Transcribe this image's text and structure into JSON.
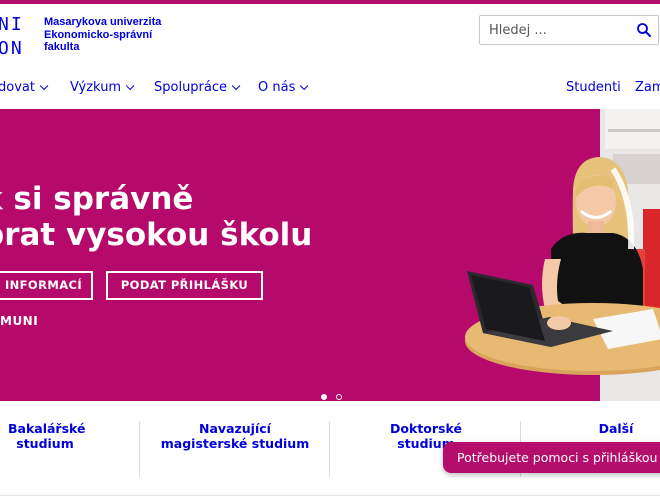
{
  "logo": {
    "mark_top": "NI",
    "mark_bottom": "ON",
    "line1": "Masarykova univerzita",
    "line2": "Ekonomicko-správní",
    "line3": "fakulta"
  },
  "search": {
    "placeholder": "Hledej ...",
    "icon": "search-icon"
  },
  "nav": {
    "items": [
      {
        "label": "dovat"
      },
      {
        "label": "Výzkum"
      },
      {
        "label": "Spolupráce"
      },
      {
        "label": "O nás"
      }
    ],
    "right": [
      {
        "label": "Studenti"
      },
      {
        "label": "Zam"
      }
    ]
  },
  "hero": {
    "title_line1": "k si správně",
    "title_line2": "brat vysokou školu",
    "button_info": "INFORMACÍ",
    "button_apply": "PODAT PŘIHLÁŠKU",
    "link": "MUNI",
    "slides_total": 2,
    "slide_active": 1,
    "bg_color": "#b5096b"
  },
  "tiles": [
    {
      "line1": "Bakalářské",
      "line2": "studium"
    },
    {
      "line1": "Navazující",
      "line2": "magisterské studium"
    },
    {
      "line1": "Doktorské",
      "line2": "studium"
    },
    {
      "line1": "Další",
      "line2": ""
    }
  ],
  "help": {
    "label": "Potřebujete pomoci s přihláškou na"
  },
  "colors": {
    "accent": "#0000dc",
    "brand": "#b50d6c"
  }
}
